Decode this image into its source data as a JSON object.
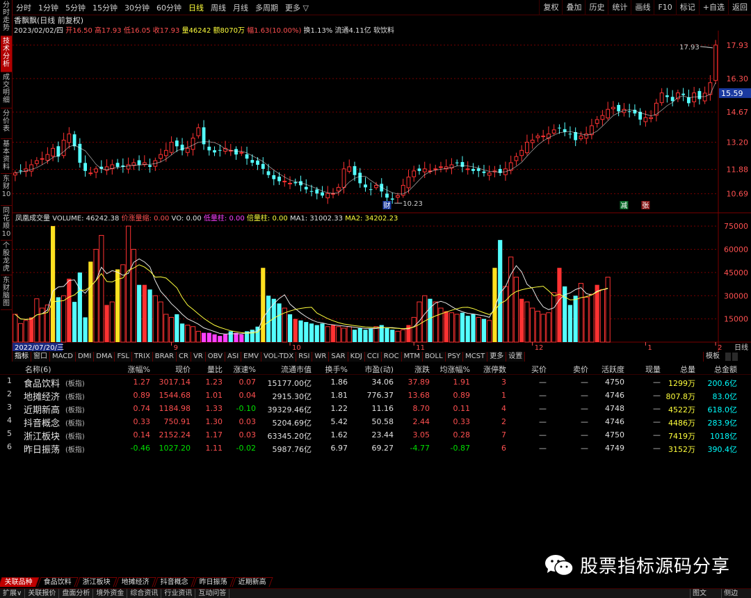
{
  "toolbar": {
    "periods": [
      "分时",
      "1分钟",
      "5分钟",
      "15分钟",
      "30分钟",
      "60分钟",
      "日线",
      "周线",
      "月线",
      "多周期",
      "更多 ▽"
    ],
    "active_period": "日线",
    "right_buttons": [
      "复权",
      "叠加",
      "历史",
      "统计",
      "画线",
      "F10",
      "标记",
      "+自选",
      "返回"
    ]
  },
  "side_tabs": [
    "分时走势",
    "技术分析",
    "成交明细",
    "分价表",
    "基本资料",
    "东财10",
    "同花顺10",
    "个股龙虎",
    "东财脑图"
  ],
  "active_side_tab": "技术分析",
  "stock": {
    "title": "香飘飘(日线 前复权)",
    "date": "2023/02/02/四",
    "open_label": "开",
    "open": "16.50",
    "high_label": "高",
    "high": "17.93",
    "low_label": "低",
    "low": "16.05",
    "close_label": "收",
    "close": "17.93",
    "vol_label": "量",
    "vol": "46242",
    "amount_label": "额",
    "amount": "8070万",
    "chg_label": "幅",
    "chg": "1.63(10.00%)",
    "turnover": "换1.13%",
    "float_cap": "流通4.11亿",
    "industry": "软饮料"
  },
  "volume_legend": {
    "title": "凤凰成交量",
    "volume": "VOLUME: 46242.38",
    "jlsq": "价涨量缩: 0.00",
    "vo": "VO: 0.00",
    "dlz": "低量柱: 0.00",
    "blz": "倍量柱: 0.00",
    "ma1": "MA1: 31002.33",
    "ma2": "MA2: 34202.23"
  },
  "price_axis": [
    "17.93",
    "16.30",
    "14.67",
    "13.20",
    "11.88",
    "10.69"
  ],
  "current_price": "15.59",
  "volume_axis": [
    "75000",
    "60000",
    "45000",
    "30000",
    "15000"
  ],
  "chart_labels": {
    "high": "17.93",
    "low": "10.23",
    "flag1": "财",
    "flag2": "减",
    "flag3": "张"
  },
  "date_axis": {
    "start": "2022/07/20/三",
    "marks": [
      "9",
      "10",
      "11",
      "12",
      "1",
      "2"
    ],
    "period": "日线"
  },
  "indicator_tabs": [
    "指标",
    "窗口",
    "MACD",
    "DMI",
    "DMA",
    "FSL",
    "TRIX",
    "BRAR",
    "CR",
    "VR",
    "OBV",
    "ASI",
    "EMV",
    "VOL-TDX",
    "RSI",
    "WR",
    "SAR",
    "KDJ",
    "CCI",
    "ROC",
    "MTM",
    "BOLL",
    "PSY",
    "MCST",
    "更多",
    "设置"
  ],
  "template_btn": "模板",
  "chart_data": {
    "type": "candlestick",
    "title": "香飘飘(日线 前复权)",
    "start_date": "2022/07/20/三",
    "x_ticks": [
      "9",
      "10",
      "11",
      "12",
      "1",
      "2"
    ],
    "price_ticks": [
      17.93,
      16.3,
      14.67,
      13.2,
      11.88,
      10.69
    ],
    "price_range": [
      10.1,
      18.5
    ],
    "volume_ticks": [
      75000,
      60000,
      45000,
      30000,
      15000
    ],
    "volume_range": [
      0,
      80000
    ],
    "closes": [
      11.7,
      11.8,
      11.9,
      12.1,
      12.3,
      12.4,
      12.6,
      12.9,
      12.5,
      13.3,
      13.6,
      13.0,
      12.2,
      11.8,
      11.7,
      11.9,
      11.9,
      12.0,
      12.1,
      12.0,
      12.0,
      12.1,
      12.2,
      12.1,
      12.2,
      12.0,
      12.3,
      12.6,
      12.8,
      13.2,
      13.0,
      12.8,
      12.9,
      13.4,
      13.9,
      13.1,
      12.8,
      12.7,
      12.8,
      12.9,
      12.8,
      12.6,
      12.7,
      12.4,
      12.2,
      12.1,
      11.9,
      11.6,
      11.4,
      11.3,
      11.3,
      11.2,
      11.2,
      11.1,
      10.9,
      10.8,
      10.7,
      10.6,
      10.7,
      10.7,
      11.0,
      11.9,
      12.0,
      11.6,
      11.2,
      11.0,
      10.9,
      11.1,
      10.8,
      10.5,
      10.4,
      10.6,
      11.1,
      11.5,
      11.8,
      11.8,
      11.9,
      11.8,
      11.9,
      12.0,
      12.0,
      12.1,
      12.2,
      12.0,
      11.9,
      11.8,
      11.8,
      11.7,
      11.7,
      11.8,
      11.7,
      11.9,
      12.2,
      12.5,
      12.8,
      13.2,
      13.3,
      13.5,
      13.5,
      13.6,
      13.8,
      13.9,
      13.7,
      13.6,
      13.3,
      13.5,
      13.6,
      14.0,
      14.3,
      14.5,
      14.8,
      14.9,
      14.7,
      14.8,
      14.7,
      14.6,
      14.3,
      14.4,
      14.4,
      15.1,
      15.6,
      15.4,
      15.2,
      15.6,
      15.5,
      15.1,
      15.6,
      15.3,
      15.59,
      16.1,
      17.93
    ],
    "volumes": [
      18000,
      12000,
      14000,
      16000,
      28000,
      22000,
      24000,
      75000,
      29000,
      30000,
      41000,
      26000,
      45000,
      16000,
      52000,
      60000,
      69000,
      24000,
      26000,
      47000,
      50000,
      75000,
      60000,
      37000,
      37000,
      34000,
      30000,
      26000,
      18000,
      16000,
      18000,
      12000,
      11000,
      10000,
      7000,
      6000,
      6000,
      5000,
      4000,
      5000,
      7000,
      6000,
      5000,
      7000,
      8000,
      10000,
      48000,
      30000,
      28000,
      25000,
      22000,
      18000,
      15000,
      14000,
      13000,
      12000,
      11000,
      12000,
      10000,
      11000,
      10000,
      9000,
      10000,
      8000,
      9000,
      8000,
      9000,
      10000,
      11000,
      9000,
      8000,
      7000,
      8000,
      11000,
      16000,
      26000,
      30000,
      28000,
      26000,
      22000,
      20000,
      19000,
      18000,
      19000,
      17000,
      18000,
      16000,
      15000,
      14000,
      48000,
      66000,
      36000,
      55000,
      42000,
      28000,
      26000,
      22000,
      20000,
      18000,
      19000,
      32000,
      48000,
      36000,
      24000,
      30000,
      38000,
      29000,
      31000,
      37000,
      34000,
      42000
    ]
  },
  "table": {
    "headers": [
      "名称(6)",
      "涨幅%",
      "现价",
      "量比",
      "涨速%",
      "流通市值",
      "换手%",
      "市盈(动)",
      "涨跌",
      "均涨幅%",
      "涨停数",
      "买价",
      "卖价",
      "活跃度",
      "现量",
      "总量",
      "总金额"
    ],
    "rows": [
      {
        "idx": "1",
        "name": "食品饮料",
        "tag": "(板指)",
        "chg": "1.27",
        "price": "3017.14",
        "vr": "1.23",
        "spd": "0.07",
        "mcap": "15177.00亿",
        "turn": "1.86",
        "pe": "34.06",
        "diff": "37.89",
        "avg": "1.91",
        "limit": "3",
        "bid": "—",
        "ask": "—",
        "act": "4750",
        "cur": "—",
        "tvol": "1299万",
        "amt": "200.6亿",
        "up": true,
        "spd_up": true
      },
      {
        "idx": "2",
        "name": "地摊经济",
        "tag": "(板指)",
        "chg": "0.89",
        "price": "1544.68",
        "vr": "1.01",
        "spd": "0.04",
        "mcap": "2915.30亿",
        "turn": "1.81",
        "pe": "776.37",
        "diff": "13.68",
        "avg": "0.89",
        "limit": "1",
        "bid": "—",
        "ask": "—",
        "act": "4746",
        "cur": "—",
        "tvol": "807.8万",
        "amt": "83.0亿",
        "up": true,
        "spd_up": true
      },
      {
        "idx": "3",
        "name": "近期新高",
        "tag": "(板指)",
        "chg": "0.74",
        "price": "1184.98",
        "vr": "1.33",
        "spd": "-0.10",
        "mcap": "39329.46亿",
        "turn": "1.22",
        "pe": "11.16",
        "diff": "8.70",
        "avg": "0.11",
        "limit": "4",
        "bid": "—",
        "ask": "—",
        "act": "4748",
        "cur": "—",
        "tvol": "4522万",
        "amt": "618.0亿",
        "up": true,
        "spd_up": false
      },
      {
        "idx": "4",
        "name": "抖音概念",
        "tag": "(板指)",
        "chg": "0.33",
        "price": "750.91",
        "vr": "1.30",
        "spd": "0.03",
        "mcap": "5204.69亿",
        "turn": "5.42",
        "pe": "50.58",
        "diff": "2.44",
        "avg": "0.33",
        "limit": "2",
        "bid": "—",
        "ask": "—",
        "act": "4746",
        "cur": "—",
        "tvol": "4486万",
        "amt": "283.9亿",
        "up": true,
        "spd_up": true
      },
      {
        "idx": "5",
        "name": "浙江板块",
        "tag": "(板指)",
        "chg": "0.14",
        "price": "2152.24",
        "vr": "1.17",
        "spd": "0.03",
        "mcap": "63345.20亿",
        "turn": "1.62",
        "pe": "23.44",
        "diff": "3.05",
        "avg": "0.28",
        "limit": "7",
        "bid": "—",
        "ask": "—",
        "act": "4750",
        "cur": "—",
        "tvol": "7419万",
        "amt": "1018亿",
        "up": true,
        "spd_up": true
      },
      {
        "idx": "6",
        "name": "昨日振荡",
        "tag": "(板指)",
        "chg": "-0.46",
        "price": "1027.20",
        "vr": "1.11",
        "spd": "-0.02",
        "mcap": "5987.76亿",
        "turn": "6.97",
        "pe": "69.27",
        "diff": "-4.77",
        "avg": "-0.87",
        "limit": "6",
        "bid": "—",
        "ask": "—",
        "act": "4749",
        "cur": "—",
        "tvol": "3152万",
        "amt": "390.4亿",
        "up": false,
        "spd_up": false
      }
    ]
  },
  "bottom_tabs": [
    "关联品种",
    "食品饮料",
    "浙江板块",
    "地摊经济",
    "抖音概念",
    "昨日振荡",
    "近期新高"
  ],
  "bottom_bar": [
    "扩展∨",
    "关联报价",
    "盘面分析",
    "境外资金",
    "综合资讯",
    "行业资讯",
    "互动问答"
  ],
  "bottom_right": [
    "图文F10",
    "侧边栏»"
  ],
  "watermark": "股票指标源码分享",
  "colors": {
    "up": "#ff3232",
    "down": "#54ffff",
    "ma_white": "#e8e8e8",
    "ma_yellow": "#ffff3c",
    "vol_yellow": "#ffe020",
    "vol_magenta": "#ff40ff",
    "grid": "#7a0000"
  }
}
